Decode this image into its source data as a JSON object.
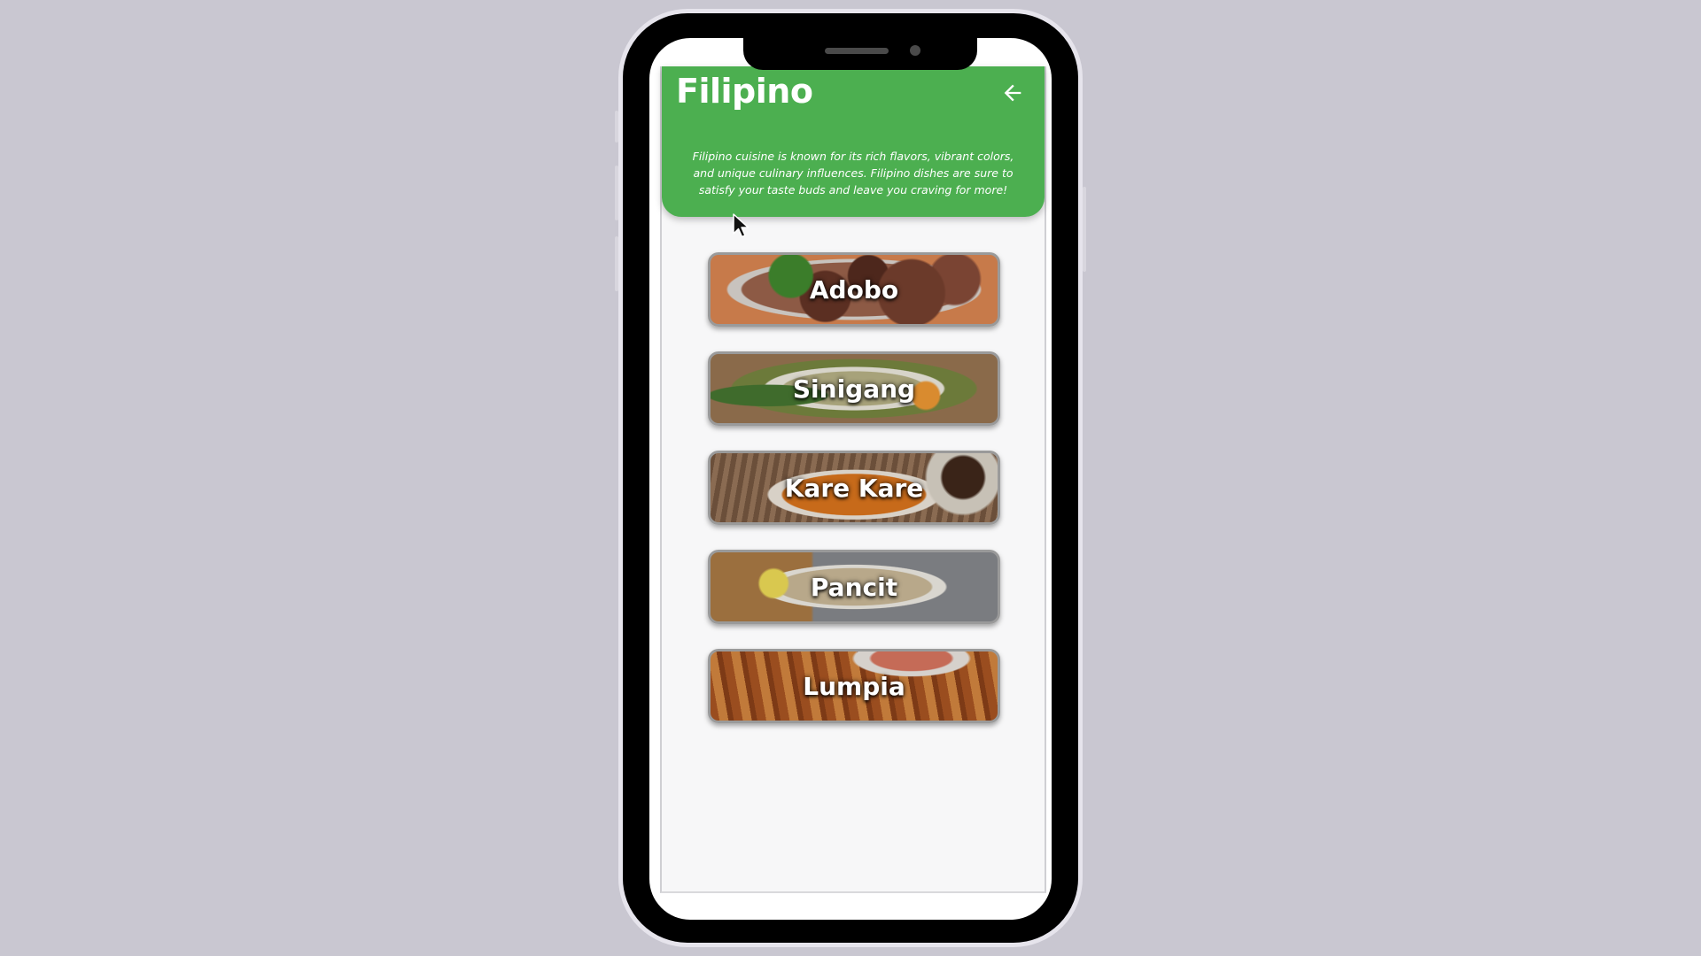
{
  "app": {
    "title": "Filipino",
    "description": "Filipino cuisine is known for its rich flavors, vibrant colors, and unique culinary influences. Filipino dishes are sure to satisfy your taste buds and leave you craving for more!"
  },
  "dishes": [
    {
      "name": "Adobo"
    },
    {
      "name": "Sinigang"
    },
    {
      "name": "Kare Kare"
    },
    {
      "name": "Pancit"
    },
    {
      "name": "Lumpia"
    }
  ],
  "colors": {
    "header": "#4caf50",
    "background": "#c9c7d1"
  },
  "icons": {
    "back": "arrow-left-icon",
    "cursor": "mouse-pointer-icon"
  }
}
